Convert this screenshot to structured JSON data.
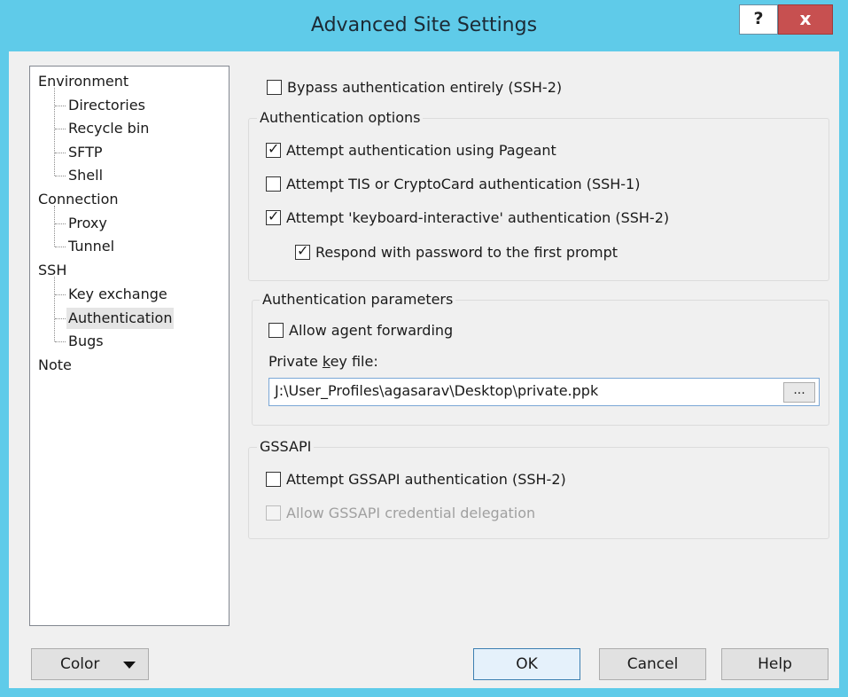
{
  "window": {
    "title": "Advanced Site Settings",
    "help_label": "?",
    "close_label": "x"
  },
  "tree": {
    "items": [
      {
        "label": "Environment",
        "level": 0
      },
      {
        "label": "Directories",
        "level": 1
      },
      {
        "label": "Recycle bin",
        "level": 1
      },
      {
        "label": "SFTP",
        "level": 1
      },
      {
        "label": "Shell",
        "level": 1
      },
      {
        "label": "Connection",
        "level": 0
      },
      {
        "label": "Proxy",
        "level": 1
      },
      {
        "label": "Tunnel",
        "level": 1
      },
      {
        "label": "SSH",
        "level": 0
      },
      {
        "label": "Key exchange",
        "level": 1
      },
      {
        "label": "Authentication",
        "level": 1,
        "selected": true
      },
      {
        "label": "Bugs",
        "level": 1
      },
      {
        "label": "Note",
        "level": 0
      }
    ]
  },
  "bypass": {
    "label": "Bypass authentication entirely (SSH-2)",
    "checked": false
  },
  "auth_options": {
    "title": "Authentication options",
    "pageant": {
      "label": "Attempt authentication using Pageant",
      "checked": true
    },
    "tis": {
      "label": "Attempt TIS or CryptoCard authentication (SSH-1)",
      "checked": false
    },
    "keyboard": {
      "label": "Attempt 'keyboard-interactive' authentication (SSH-2)",
      "checked": true
    },
    "respond": {
      "label": "Respond with password to the first prompt",
      "checked": true
    }
  },
  "auth_params": {
    "title": "Authentication parameters",
    "agent_forwarding": {
      "label": "Allow agent forwarding",
      "checked": false
    },
    "private_key_label_pre": "Private ",
    "private_key_label_u": "k",
    "private_key_label_post": "ey file:",
    "private_key_value": "J:\\User_Profiles\\agasarav\\Desktop\\private.ppk",
    "browse_label": "..."
  },
  "gssapi": {
    "title": "GSSAPI",
    "attempt": {
      "label": "Attempt GSSAPI authentication (SSH-2)",
      "checked": false
    },
    "delegation": {
      "label": "Allow GSSAPI credential delegation",
      "checked": false,
      "disabled": true
    }
  },
  "buttons": {
    "color": "Color",
    "ok": "OK",
    "cancel": "Cancel",
    "help": "Help"
  },
  "colors": {
    "titlebar": "#5fcbe9",
    "close": "#c75050",
    "dialog_bg": "#f0f0f0"
  }
}
